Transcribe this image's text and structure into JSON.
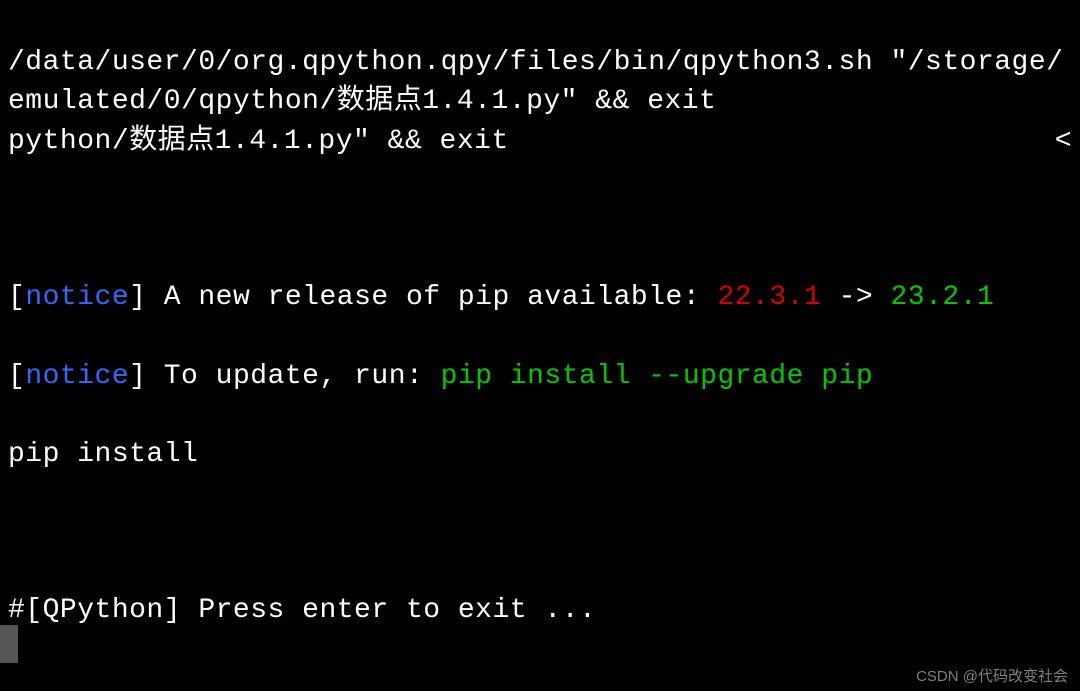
{
  "terminal": {
    "line1": "/data/user/0/org.qpython.qpy/files/bin/qpython3.sh \"/storage/emulated/0/qpython/数据点1.4.1.py\" && exit",
    "line2_main": "python/数据点1.4.1.py\" && exit",
    "line2_arrow": "<",
    "notice1_bracket_open": "[",
    "notice1_word": "notice",
    "notice1_bracket_close": "]",
    "notice1_text": " A new release of pip available: ",
    "notice1_old_version": "22.3.1",
    "notice1_arrow": " -> ",
    "notice1_new_version": "23.2.1",
    "notice2_bracket_open": "[",
    "notice2_word": "notice",
    "notice2_bracket_close": "]",
    "notice2_text": " To update, run: ",
    "notice2_cmd": "pip install --upgrade pip",
    "pip_install": "pip install",
    "exit_prompt": "#[QPython] Press enter to exit ..."
  },
  "watermark": "CSDN @代码改变社会",
  "colors": {
    "bg": "#000000",
    "white": "#ffffff",
    "blue": "#3467ff",
    "red": "#d40000",
    "green": "#00c800",
    "cursor": "#565656",
    "watermark": "#808080"
  }
}
